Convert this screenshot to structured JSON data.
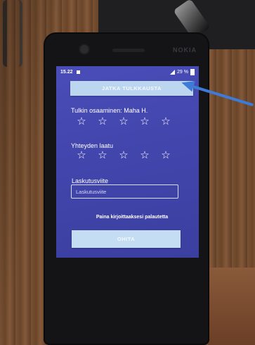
{
  "status_bar": {
    "time": "15.22",
    "battery": "29 %"
  },
  "phone": {
    "brand": "NOKIA"
  },
  "app": {
    "continue_button": "JATKA TULKKAUSTA",
    "interpreter_rating_label": "Tulkin osaaminen: Maha H.",
    "connection_rating_label": "Yhteyden laatu",
    "billing_ref_label": "Laskutusviite",
    "billing_ref_placeholder": "Laskutusviite",
    "feedback_link": "Paina kirjoittaaksesi palautetta",
    "send_button": "OHITA"
  },
  "ratings": {
    "interpreter_stars": [
      "☆",
      "☆",
      "☆",
      "☆",
      "☆"
    ],
    "connection_stars": [
      "☆",
      "☆",
      "☆",
      "☆",
      "☆"
    ]
  },
  "colors": {
    "screen_bg": "#4346ad",
    "button_bg": "#bcd6ef",
    "annotation_arrow": "#3d7bd6"
  }
}
